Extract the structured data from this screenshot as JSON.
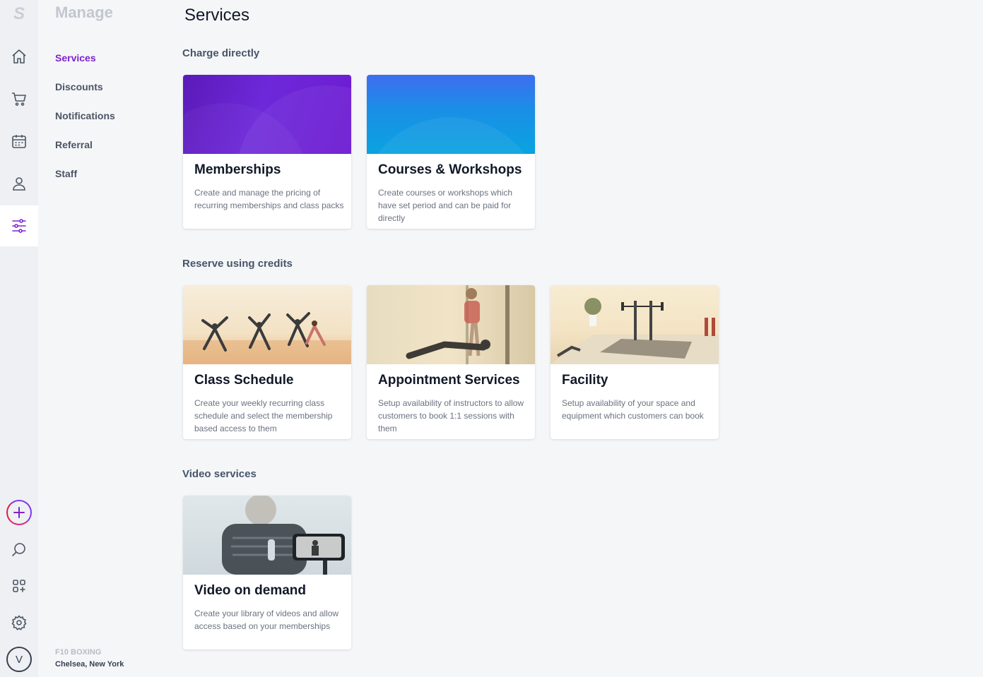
{
  "rail": {
    "logo": "S",
    "icons": [
      "home-icon",
      "cart-icon",
      "calendar-icon",
      "user-icon",
      "sliders-icon"
    ],
    "bottom_icons": [
      "add-icon",
      "search-icon",
      "apps-icon",
      "gear-icon"
    ],
    "avatar_initial": "V",
    "accent": "#7e22ce"
  },
  "subnav": {
    "title": "Manage",
    "items": [
      {
        "label": "Services",
        "active": true
      },
      {
        "label": "Discounts",
        "active": false
      },
      {
        "label": "Notifications",
        "active": false
      },
      {
        "label": "Referral",
        "active": false
      },
      {
        "label": "Staff",
        "active": false
      }
    ],
    "business_name": "F10 BOXING",
    "location": "Chelsea, New York"
  },
  "main": {
    "title": "Services",
    "sections": [
      {
        "title": "Charge directly",
        "cards": [
          {
            "title": "Memberships",
            "description": "Create and manage the pricing of recurring memberships and class packs"
          },
          {
            "title": "Courses & Workshops",
            "description": "Create courses or workshops which have set period and can be paid for directly"
          }
        ]
      },
      {
        "title": "Reserve using credits",
        "cards": [
          {
            "title": "Class Schedule",
            "description": "Create your weekly recurring class schedule and select the membership based access to them"
          },
          {
            "title": "Appointment Services",
            "description": "Setup availability of instructors to allow customers to book 1:1 sessions with them"
          },
          {
            "title": "Facility",
            "description": "Setup availability of your space and equipment which customers can book"
          }
        ]
      },
      {
        "title": "Video services",
        "cards": [
          {
            "title": "Video on demand",
            "description": "Create your library of videos and allow access based on your memberships"
          }
        ]
      }
    ]
  }
}
